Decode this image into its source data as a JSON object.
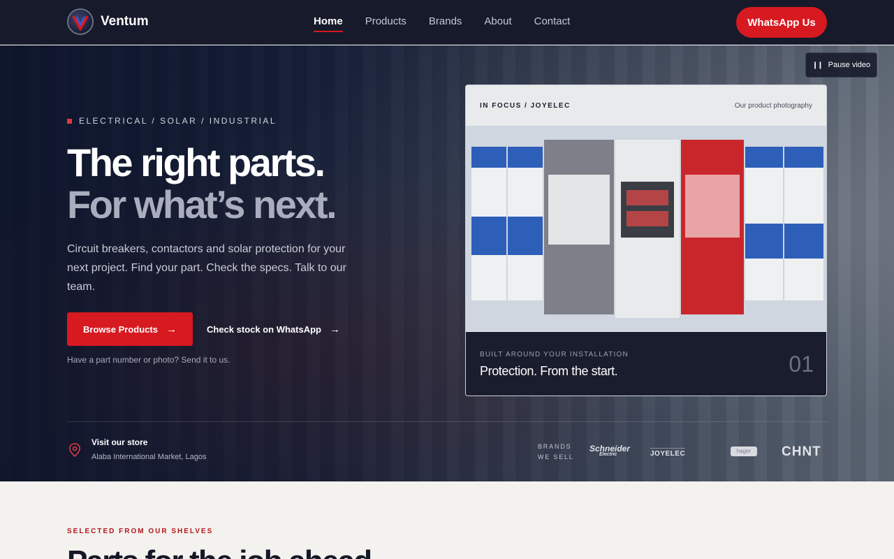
{
  "header": {
    "brand": "Ventum",
    "nav": [
      {
        "label": "Home",
        "active": true
      },
      {
        "label": "Products"
      },
      {
        "label": "Brands"
      },
      {
        "label": "About"
      },
      {
        "label": "Contact"
      }
    ],
    "cta_label": "WhatsApp Us"
  },
  "hero": {
    "pause_label": "Pause video",
    "eyebrow": "ELECTRICAL / SOLAR / INDUSTRIAL",
    "title_line1": "The right parts.",
    "title_line2": "For what’s next.",
    "lead": "Circuit breakers, contactors and solar protection for your next project. Find your part. Check the specs. Talk to our team.",
    "primary_cta": "Browse Products",
    "secondary_cta": "Check stock on WhatsApp",
    "hint": "Have a part number or photo? Send it to us."
  },
  "focus_card": {
    "kicker": "IN FOCUS / JOYELEC",
    "meta": "Our product photography",
    "eyebrow": "BUILT AROUND YOUR INSTALLATION",
    "title": "Protection. From the start.",
    "index": "01"
  },
  "strip": {
    "store_title": "Visit our store",
    "store_address": "Alaba International Market, Lagos",
    "brands_label_1": "BRANDS",
    "brands_label_2": "WE SELL",
    "brands": [
      "Schneider",
      "JOYELEC",
      "hager",
      "CHNT"
    ],
    "schneider_sub": "Electric"
  },
  "section": {
    "eyebrow": "SELECTED FROM OUR SHELVES",
    "title": "Parts for the job ahead."
  },
  "colors": {
    "accent": "#d71920",
    "header_bg": "#161a2b",
    "card_dark": "#1a1d2d"
  }
}
